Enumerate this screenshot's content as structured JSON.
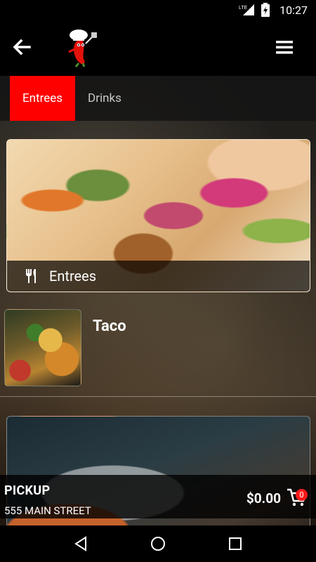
{
  "status_bar": {
    "network": "LTE",
    "time": "10:27"
  },
  "app_bar": {
    "back_icon": "arrow-left-icon",
    "logo": "chili-chef-logo",
    "menu_icon": "hamburger-menu-icon"
  },
  "tabs": [
    {
      "label": "Entrees",
      "active": true
    },
    {
      "label": "Drinks",
      "active": false
    }
  ],
  "category_card": {
    "label": "Entrees",
    "icon": "fork-knife-icon"
  },
  "items": [
    {
      "name": "Taco"
    }
  ],
  "order_bar": {
    "mode": "PICKUP",
    "address": "555 MAIN STREET",
    "total": "$0.00",
    "cart_count": "0"
  },
  "colors": {
    "accent": "#ff0000",
    "background": "#000000"
  }
}
